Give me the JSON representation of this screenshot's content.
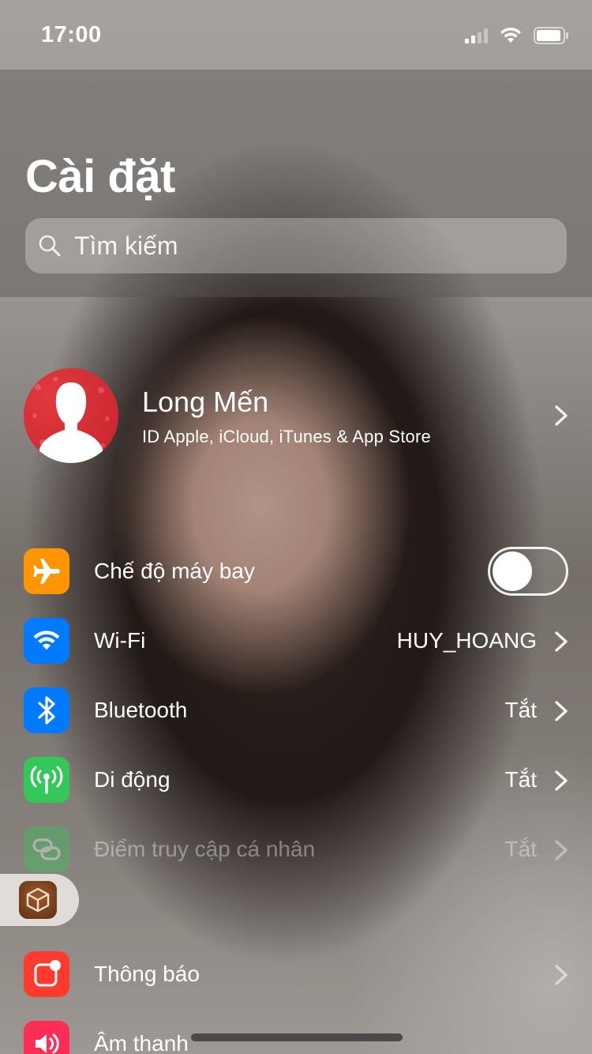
{
  "status_bar": {
    "time": "17:00",
    "icons": [
      "cellular-signal-icon",
      "wifi-icon",
      "battery-icon"
    ]
  },
  "header": {
    "title": "Cài đặt",
    "search": {
      "placeholder": "Tìm kiếm",
      "icon": "search-icon"
    }
  },
  "profile": {
    "name": "Long Mến",
    "subtitle": "ID Apple, iCloud, iTunes & App Store",
    "avatar_icon": "person-silhouette-icon"
  },
  "settings": {
    "rows": [
      {
        "label": "Chế độ máy bay",
        "value": "",
        "icon": "airplane-icon",
        "icon_color": "#FF9500",
        "toggle": true,
        "toggle_on": false
      },
      {
        "label": "Wi-Fi",
        "value": "HUY_HOANG",
        "icon": "wifi-icon",
        "icon_color": "#007AFF"
      },
      {
        "label": "Bluetooth",
        "value": "Tắt",
        "icon": "bluetooth-icon",
        "icon_color": "#007AFF"
      },
      {
        "label": "Di động",
        "value": "Tắt",
        "icon": "cellular-antenna-icon",
        "icon_color": "#34C759"
      },
      {
        "label": "Điểm truy cập cá nhân",
        "value": "Tắt",
        "icon": "hotspot-icon",
        "icon_color": "#34C759",
        "disabled": true
      },
      {
        "label": "Thông báo",
        "value": "",
        "icon": "notifications-icon",
        "icon_color": "#FF3B30"
      },
      {
        "label": "Âm thanh",
        "value": "",
        "icon": "sound-icon",
        "icon_color": "#FF2D55"
      }
    ]
  },
  "assistive_touch": {
    "icon": "cydia-app-icon"
  },
  "colors": {
    "accent": "#007AFF",
    "toggle_off_border": "#FFFFFF"
  }
}
